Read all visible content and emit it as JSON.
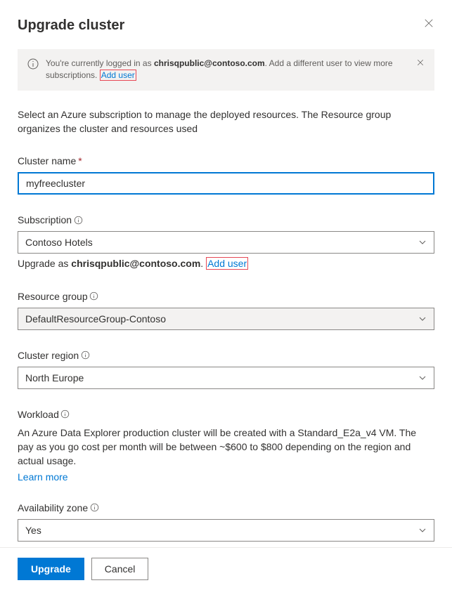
{
  "header": {
    "title": "Upgrade cluster"
  },
  "infoBar": {
    "prefix": "You're currently logged in as ",
    "user": "chrisqpublic@contoso.com",
    "suffix": ". Add a different user to view more subscriptions. ",
    "addUserLabel": "Add user"
  },
  "description": "Select an Azure subscription to manage the deployed resources. The Resource group organizes the cluster and resources used",
  "fields": {
    "clusterName": {
      "label": "Cluster name",
      "required": "*",
      "value": "myfreecluster"
    },
    "subscription": {
      "label": "Subscription",
      "value": "Contoso Hotels",
      "helperPrefix": "Upgrade as ",
      "helperUser": "chrisqpublic@contoso.com",
      "addUserLabel": "Add user"
    },
    "resourceGroup": {
      "label": "Resource group",
      "value": "DefaultResourceGroup-Contoso"
    },
    "clusterRegion": {
      "label": "Cluster region",
      "value": "North Europe"
    },
    "workload": {
      "label": "Workload",
      "body": "An Azure Data Explorer production cluster will be created with a Standard_E2a_v4 VM. The pay as you go cost per month will be between ~$600 to $800 depending on the region and actual usage.",
      "learnMoreLabel": "Learn more"
    },
    "availabilityZone": {
      "label": "Availability zone",
      "value": "Yes"
    }
  },
  "footer": {
    "primary": "Upgrade",
    "secondary": "Cancel"
  }
}
